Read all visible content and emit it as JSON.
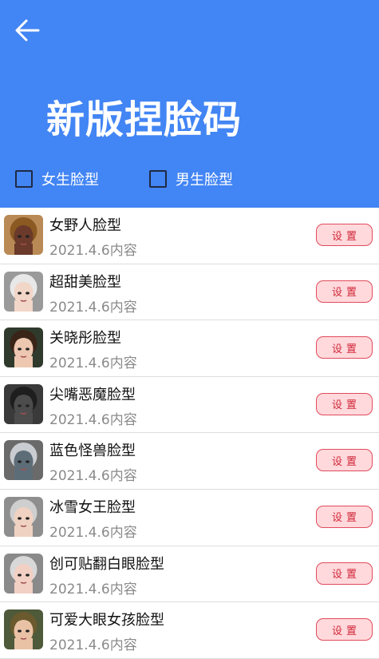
{
  "header": {
    "back_icon": "arrow-left-icon",
    "title": "新版捏脸码",
    "background_color": "#4285f4"
  },
  "filters": [
    {
      "label": "女生脸型",
      "checked": false
    },
    {
      "label": "男生脸型",
      "checked": false
    }
  ],
  "items": [
    {
      "title": "女野人脸型",
      "subtitle": "2021.4.6内容",
      "button": "设置",
      "skin": "#6b3a2a",
      "hair": "#8a5a22",
      "bg": "#b98a55"
    },
    {
      "title": "超甜美脸型",
      "subtitle": "2021.4.6内容",
      "button": "设置",
      "skin": "#f2d6c8",
      "hair": "#e8e8e8",
      "bg": "#9a9a9a"
    },
    {
      "title": "关晓彤脸型",
      "subtitle": "2021.4.6内容",
      "button": "设置",
      "skin": "#edc7b0",
      "hair": "#3a2418",
      "bg": "#2f3a2c"
    },
    {
      "title": "尖嘴恶魔脸型",
      "subtitle": "2021.4.6内容",
      "button": "设置",
      "skin": "#4c4c4c",
      "hair": "#1e1e1e",
      "bg": "#3a3a3a"
    },
    {
      "title": "蓝色怪兽脸型",
      "subtitle": "2021.4.6内容",
      "button": "设置",
      "skin": "#5d6d78",
      "hair": "#c9ccd0",
      "bg": "#6a6a6a"
    },
    {
      "title": "冰雪女王脸型",
      "subtitle": "2021.4.6内容",
      "button": "设置",
      "skin": "#f0d2c2",
      "hair": "#cfcfcf",
      "bg": "#8e8e8e"
    },
    {
      "title": "创可贴翻白眼脸型",
      "subtitle": "2021.4.6内容",
      "button": "设置",
      "skin": "#f2d0c4",
      "hair": "#d8d8d8",
      "bg": "#8a8a8a"
    },
    {
      "title": "可爱大眼女孩脸型",
      "subtitle": "2021.4.6内容",
      "button": "设置",
      "skin": "#e9c2a6",
      "hair": "#6a5a2e",
      "bg": "#4e5a3a"
    }
  ]
}
